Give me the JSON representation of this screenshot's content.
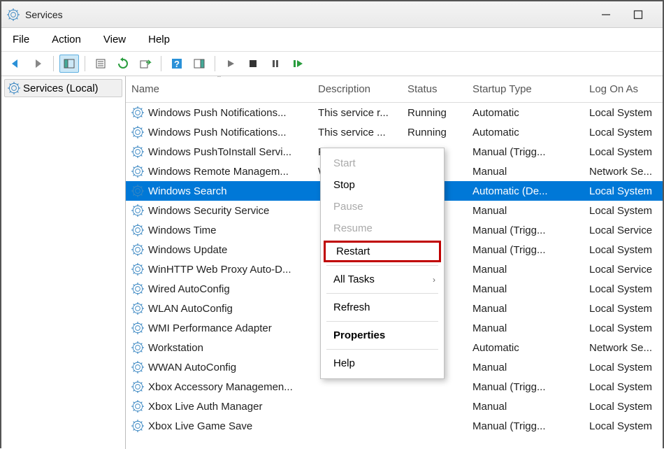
{
  "window": {
    "title": "Services"
  },
  "menubar": {
    "file": "File",
    "action": "Action",
    "view": "View",
    "help": "Help"
  },
  "tree": {
    "root": "Services (Local)"
  },
  "columns": {
    "name": "Name",
    "description": "Description",
    "status": "Status",
    "startup": "Startup Type",
    "logon": "Log On As"
  },
  "rows": [
    {
      "name": "Windows Push Notifications...",
      "desc": "This service r...",
      "status": "Running",
      "startup": "Automatic",
      "logon": "Local System",
      "selected": false
    },
    {
      "name": "Windows Push Notifications...",
      "desc": "This service ...",
      "status": "Running",
      "startup": "Automatic",
      "logon": "Local System",
      "selected": false
    },
    {
      "name": "Windows PushToInstall Servi...",
      "desc": "Provides infr...",
      "status": "",
      "startup": "Manual (Trigg...",
      "logon": "Local System",
      "selected": false
    },
    {
      "name": "Windows Remote Managem...",
      "desc": "Windows Re...",
      "status": "",
      "startup": "Manual",
      "logon": "Network Se...",
      "selected": false
    },
    {
      "name": "Windows Search",
      "desc": "",
      "status": "",
      "startup": "Automatic (De...",
      "logon": "Local System",
      "selected": true
    },
    {
      "name": "Windows Security Service",
      "desc": "",
      "status": "",
      "startup": "Manual",
      "logon": "Local System",
      "selected": false
    },
    {
      "name": "Windows Time",
      "desc": "",
      "status": "",
      "startup": "Manual (Trigg...",
      "logon": "Local Service",
      "selected": false
    },
    {
      "name": "Windows Update",
      "desc": "",
      "status": "",
      "startup": "Manual (Trigg...",
      "logon": "Local System",
      "selected": false
    },
    {
      "name": "WinHTTP Web Proxy Auto-D...",
      "desc": "",
      "status": "",
      "startup": "Manual",
      "logon": "Local Service",
      "selected": false
    },
    {
      "name": "Wired AutoConfig",
      "desc": "",
      "status": "",
      "startup": "Manual",
      "logon": "Local System",
      "selected": false
    },
    {
      "name": "WLAN AutoConfig",
      "desc": "",
      "status": "",
      "startup": "Manual",
      "logon": "Local System",
      "selected": false
    },
    {
      "name": "WMI Performance Adapter",
      "desc": "",
      "status": "",
      "startup": "Manual",
      "logon": "Local System",
      "selected": false
    },
    {
      "name": "Workstation",
      "desc": "",
      "status": "",
      "startup": "Automatic",
      "logon": "Network Se...",
      "selected": false
    },
    {
      "name": "WWAN AutoConfig",
      "desc": "",
      "status": "",
      "startup": "Manual",
      "logon": "Local System",
      "selected": false
    },
    {
      "name": "Xbox Accessory Managemen...",
      "desc": "",
      "status": "",
      "startup": "Manual (Trigg...",
      "logon": "Local System",
      "selected": false
    },
    {
      "name": "Xbox Live Auth Manager",
      "desc": "",
      "status": "",
      "startup": "Manual",
      "logon": "Local System",
      "selected": false
    },
    {
      "name": "Xbox Live Game Save",
      "desc": "",
      "status": "",
      "startup": "Manual (Trigg...",
      "logon": "Local System",
      "selected": false
    }
  ],
  "context_menu": {
    "start": "Start",
    "stop": "Stop",
    "pause": "Pause",
    "resume": "Resume",
    "restart": "Restart",
    "all_tasks": "All Tasks",
    "refresh": "Refresh",
    "properties": "Properties",
    "help": "Help"
  }
}
